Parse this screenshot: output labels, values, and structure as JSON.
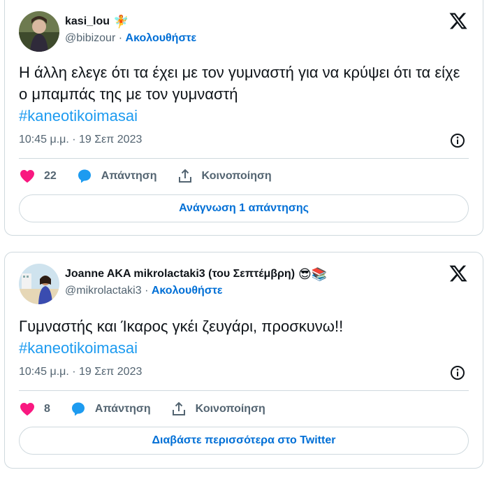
{
  "tweets": [
    {
      "display_name": "kasi_lou",
      "emoji": "🧚",
      "handle": "@bibizour",
      "separator": "·",
      "follow_label": "Ακολουθήστε",
      "text": "Η άλλη ελεγε ότι τα έχει με τον γυμναστή για να κρύψει ότι τα είχε ο μπαμπάς της με τον γυμναστή",
      "hashtag": "#kaneotikoimasai",
      "timestamp": "10:45 μ.μ. · 19 Σεπ 2023",
      "likes": "22",
      "reply_label": "Απάντηση",
      "share_label": "Κοινοποίηση",
      "cta_label": "Ανάγνωση 1 απάντησης"
    },
    {
      "display_name": "Joanne AKA mikrolactaki3 (του Σεπτέμβρη)",
      "emoji": "😎📚",
      "handle": "@mikrolactaki3",
      "separator": "·",
      "follow_label": "Ακολουθήστε",
      "text": "Γυμναστής και Ίκαρος γκέι ζευγάρι, προσκυνω!!",
      "hashtag": "#kaneotikoimasai",
      "timestamp": "10:45 μ.μ. · 19 Σεπ 2023",
      "likes": "8",
      "reply_label": "Απάντηση",
      "share_label": "Κοινοποίηση",
      "cta_label": "Διαβάστε περισσότερα στο Twitter"
    }
  ],
  "colors": {
    "like": "#f91880",
    "reply": "#1d9bf0",
    "link": "#006fd6",
    "hashtag": "#1d9bf0",
    "border": "#cfd9de",
    "muted": "#536471"
  },
  "icons": [
    "x-logo-icon",
    "info-icon",
    "heart-icon",
    "reply-bubble-icon",
    "share-icon"
  ]
}
